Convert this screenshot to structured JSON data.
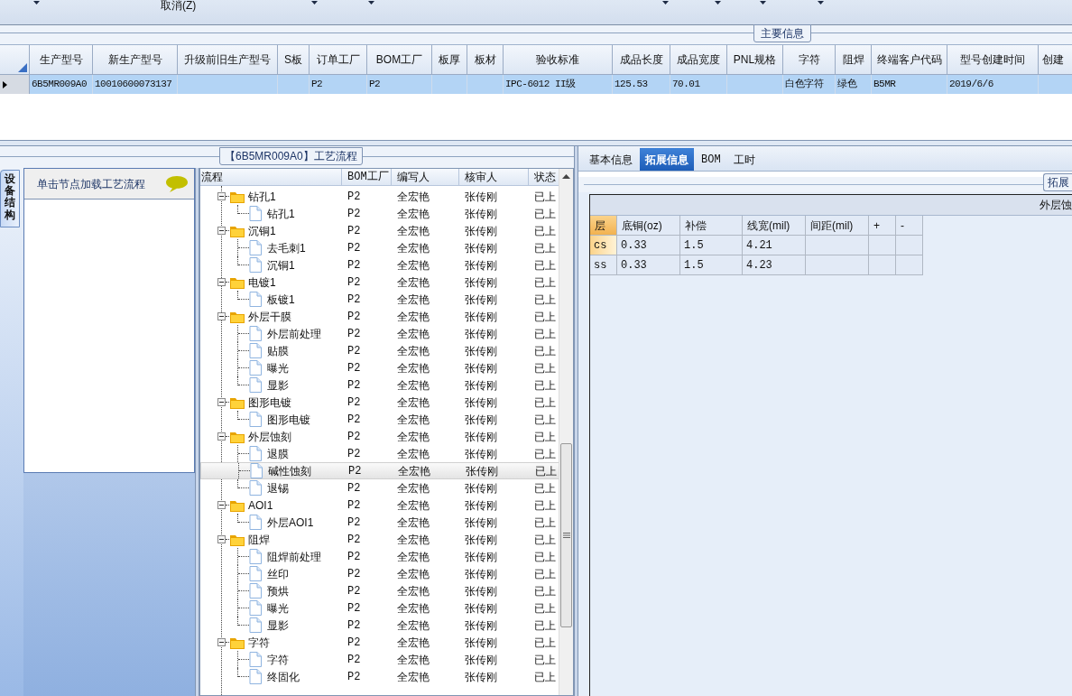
{
  "toolbar": {
    "cancel_label": "取消(Z)"
  },
  "main_info": {
    "title": "主要信息",
    "columns": [
      "生产型号",
      "新生产型号",
      "升级前旧生产型号",
      "S板",
      "订单工厂",
      "BOM工厂",
      "板厚",
      "板材",
      "验收标准",
      "成品长度",
      "成品宽度",
      "PNL规格",
      "字符",
      "阻焊",
      "终端客户代码",
      "型号创建时间",
      "创建"
    ],
    "rows": [
      {
        "selected": true,
        "cells": [
          "6B5MR009A0",
          "10010600073137",
          null,
          null,
          "P2",
          "P2",
          null,
          null,
          "IPC-6012 II级",
          "125.53",
          "70.01",
          null,
          "白色字符",
          "绿色",
          "B5MR",
          "2019/6/6",
          null
        ]
      }
    ]
  },
  "process": {
    "title": "【6B5MR009A0】工艺流程",
    "side_tab": "设备结构",
    "hint": "单击节点加载工艺流程",
    "columns": [
      "流程",
      "BOM工厂",
      "编写人",
      "核审人",
      "状态"
    ],
    "tree": [
      {
        "name": "钻孔1",
        "expanded": true,
        "selected": false,
        "cells": [
          "P2",
          "全宏艳",
          "张传刚",
          "已上"
        ],
        "children": [
          {
            "name": "钻孔1",
            "selected": false,
            "cells": [
              "P2",
              "全宏艳",
              "张传刚",
              "已上"
            ]
          }
        ]
      },
      {
        "name": "沉铜1",
        "expanded": true,
        "selected": false,
        "cells": [
          "P2",
          "全宏艳",
          "张传刚",
          "已上"
        ],
        "children": [
          {
            "name": "去毛刺1",
            "selected": false,
            "cells": [
              "P2",
              "全宏艳",
              "张传刚",
              "已上"
            ]
          },
          {
            "name": "沉铜1",
            "selected": false,
            "cells": [
              "P2",
              "全宏艳",
              "张传刚",
              "已上"
            ]
          }
        ]
      },
      {
        "name": "电镀1",
        "expanded": true,
        "selected": false,
        "cells": [
          "P2",
          "全宏艳",
          "张传刚",
          "已上"
        ],
        "children": [
          {
            "name": "板镀1",
            "selected": false,
            "cells": [
              "P2",
              "全宏艳",
              "张传刚",
              "已上"
            ]
          }
        ]
      },
      {
        "name": "外层干膜",
        "expanded": true,
        "selected": false,
        "cells": [
          "P2",
          "全宏艳",
          "张传刚",
          "已上"
        ],
        "children": [
          {
            "name": "外层前处理",
            "selected": false,
            "cells": [
              "P2",
              "全宏艳",
              "张传刚",
              "已上"
            ]
          },
          {
            "name": "贴膜",
            "selected": false,
            "cells": [
              "P2",
              "全宏艳",
              "张传刚",
              "已上"
            ]
          },
          {
            "name": "曝光",
            "selected": false,
            "cells": [
              "P2",
              "全宏艳",
              "张传刚",
              "已上"
            ]
          },
          {
            "name": "显影",
            "selected": false,
            "cells": [
              "P2",
              "全宏艳",
              "张传刚",
              "已上"
            ]
          }
        ]
      },
      {
        "name": "图形电镀",
        "expanded": true,
        "selected": false,
        "cells": [
          "P2",
          "全宏艳",
          "张传刚",
          "已上"
        ],
        "children": [
          {
            "name": "图形电镀",
            "selected": false,
            "cells": [
              "P2",
              "全宏艳",
              "张传刚",
              "已上"
            ]
          }
        ]
      },
      {
        "name": "外层蚀刻",
        "expanded": true,
        "selected": false,
        "cells": [
          "P2",
          "全宏艳",
          "张传刚",
          "已上"
        ],
        "children": [
          {
            "name": "退膜",
            "selected": false,
            "cells": [
              "P2",
              "全宏艳",
              "张传刚",
              "已上"
            ]
          },
          {
            "name": "碱性蚀刻",
            "selected": true,
            "cells": [
              "P2",
              "全宏艳",
              "张传刚",
              "已上"
            ]
          },
          {
            "name": "退锡",
            "selected": false,
            "cells": [
              "P2",
              "全宏艳",
              "张传刚",
              "已上"
            ]
          }
        ]
      },
      {
        "name": "AOI1",
        "expanded": true,
        "selected": false,
        "cells": [
          "P2",
          "全宏艳",
          "张传刚",
          "已上"
        ],
        "children": [
          {
            "name": "外层AOI1",
            "selected": false,
            "cells": [
              "P2",
              "全宏艳",
              "张传刚",
              "已上"
            ]
          }
        ]
      },
      {
        "name": "阻焊",
        "expanded": true,
        "selected": false,
        "cells": [
          "P2",
          "全宏艳",
          "张传刚",
          "已上"
        ],
        "children": [
          {
            "name": "阻焊前处理",
            "selected": false,
            "cells": [
              "P2",
              "全宏艳",
              "张传刚",
              "已上"
            ]
          },
          {
            "name": "丝印",
            "selected": false,
            "cells": [
              "P2",
              "全宏艳",
              "张传刚",
              "已上"
            ]
          },
          {
            "name": "预烘",
            "selected": false,
            "cells": [
              "P2",
              "全宏艳",
              "张传刚",
              "已上"
            ]
          },
          {
            "name": "曝光",
            "selected": false,
            "cells": [
              "P2",
              "全宏艳",
              "张传刚",
              "已上"
            ]
          },
          {
            "name": "显影",
            "selected": false,
            "cells": [
              "P2",
              "全宏艳",
              "张传刚",
              "已上"
            ]
          }
        ]
      },
      {
        "name": "字符",
        "expanded": true,
        "selected": false,
        "cells": [
          "P2",
          "全宏艳",
          "张传刚",
          "已上"
        ],
        "children": [
          {
            "name": "字符",
            "selected": false,
            "cells": [
              "P2",
              "全宏艳",
              "张传刚",
              "已上"
            ]
          },
          {
            "name": "终固化",
            "selected": false,
            "cells": [
              "P2",
              "全宏艳",
              "张传刚",
              "已上"
            ]
          }
        ]
      }
    ]
  },
  "details": {
    "tabs": [
      {
        "label": "基本信息",
        "selected": false
      },
      {
        "label": "拓展信息",
        "selected": true
      },
      {
        "label": "BOM",
        "selected": false
      },
      {
        "label": "工时",
        "selected": false
      }
    ],
    "group_title": "拓展",
    "table_title": "外层蚀",
    "columns": [
      "层",
      "底铜(oz)",
      "补偿",
      "线宽(mil)",
      "间距(mil)",
      "+",
      "-"
    ],
    "rows": [
      {
        "selected": true,
        "cells": [
          "cs",
          "0.33",
          "1.5",
          "4.21",
          null,
          null,
          null
        ]
      },
      {
        "selected": false,
        "cells": [
          "ss",
          "0.33",
          "1.5",
          "4.23",
          null,
          null,
          null
        ]
      }
    ]
  }
}
